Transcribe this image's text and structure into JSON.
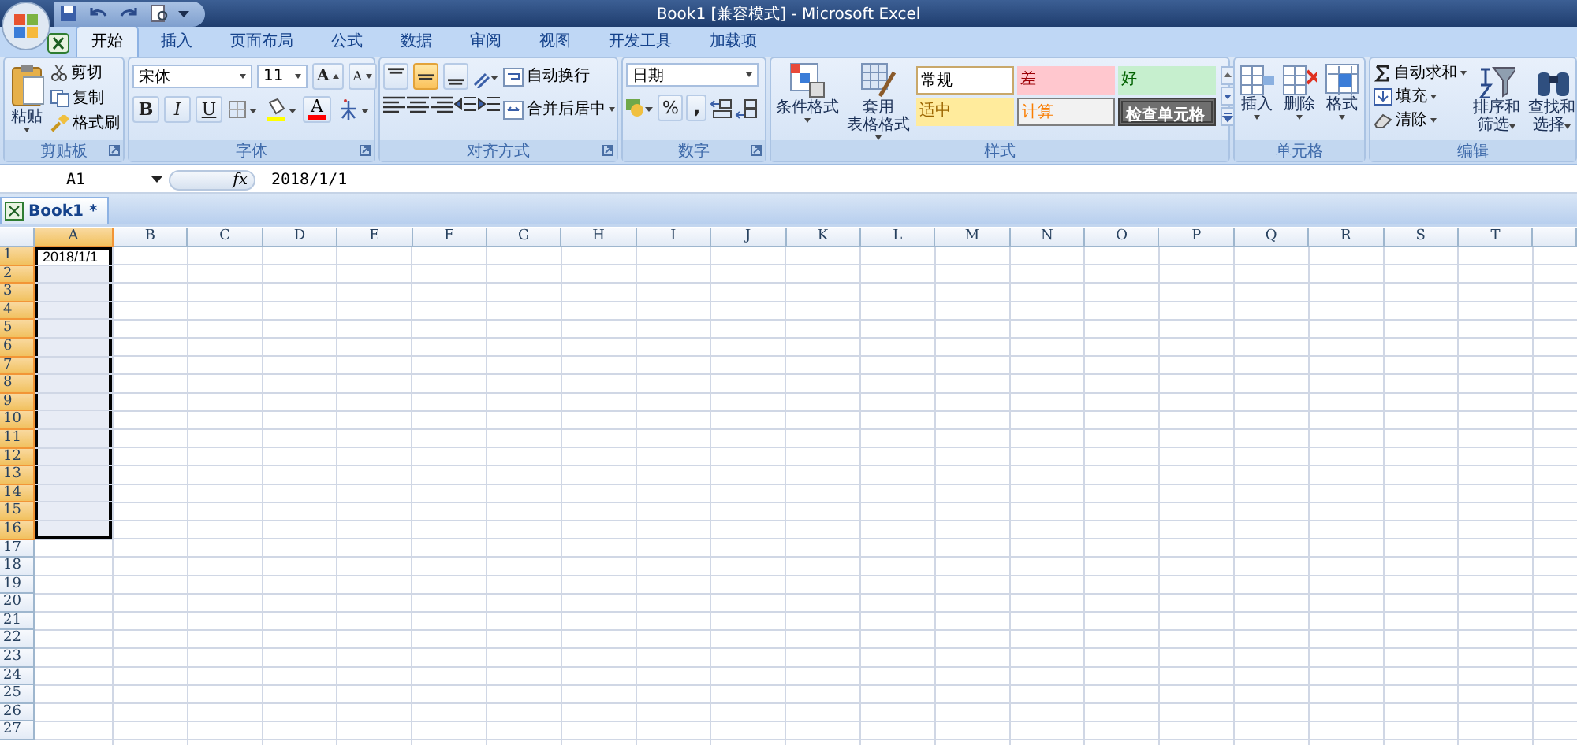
{
  "window": {
    "title": "Book1  [兼容模式] - Microsoft Excel"
  },
  "tabs": [
    {
      "label": "开始",
      "selected": true
    },
    {
      "label": "插入",
      "selected": false
    },
    {
      "label": "页面布局",
      "selected": false
    },
    {
      "label": "公式",
      "selected": false
    },
    {
      "label": "数据",
      "selected": false
    },
    {
      "label": "审阅",
      "selected": false
    },
    {
      "label": "视图",
      "selected": false
    },
    {
      "label": "开发工具",
      "selected": false
    },
    {
      "label": "加载项",
      "selected": false
    }
  ],
  "ribbon": {
    "groups": [
      {
        "kind": "clipboard",
        "label": "剪贴板",
        "large": "粘贴",
        "items": [
          "剪切",
          "复制",
          "格式刷"
        ]
      },
      {
        "kind": "font",
        "label": "字体",
        "font": "宋体",
        "size": "11",
        "grow": "A",
        "shrink": "A",
        "bold": "B",
        "italic": "I",
        "underline": "U",
        "font_color": "A"
      },
      {
        "kind": "alignment",
        "label": "对齐方式",
        "valign": [
          {
            "selected": false
          },
          {
            "selected": true
          },
          {
            "selected": false
          }
        ],
        "wrap": "自动换行",
        "merge": "合并后居中"
      },
      {
        "kind": "number",
        "label": "数字",
        "format": "日期",
        "percent": "%",
        "comma": ","
      },
      {
        "kind": "styles",
        "label": "样式",
        "buttons": [
          [
            "条件格式"
          ],
          [
            "套用",
            "表格格式"
          ]
        ],
        "gallery": [
          {
            "label": "常规",
            "kind": "normal"
          },
          {
            "label": "差",
            "kind": "bad"
          },
          {
            "label": "好",
            "kind": "good"
          },
          {
            "label": "适中",
            "kind": "neutral"
          },
          {
            "label": "计算",
            "kind": "calculation"
          },
          {
            "label": "检查单元格",
            "kind": "check"
          }
        ]
      },
      {
        "kind": "cells",
        "label": "单元格",
        "buttons": [
          "插入",
          "删除",
          "格式"
        ]
      },
      {
        "kind": "editing",
        "label": "编辑",
        "small": [
          "自动求和",
          "填充",
          "清除"
        ],
        "large": [
          [
            "排序和",
            "筛选"
          ],
          [
            "查找和",
            "选择"
          ]
        ]
      }
    ]
  },
  "formula_bar": {
    "name_box": "A1",
    "function_label": "fx",
    "value": "2018/1/1"
  },
  "workbook_tab": {
    "label": "Book1 *"
  },
  "sheet": {
    "columns": [
      {
        "label": "A",
        "selected": true
      },
      {
        "label": "B",
        "selected": false
      },
      {
        "label": "C",
        "selected": false
      },
      {
        "label": "D",
        "selected": false
      },
      {
        "label": "E",
        "selected": false
      },
      {
        "label": "F",
        "selected": false
      },
      {
        "label": "G",
        "selected": false
      },
      {
        "label": "H",
        "selected": false
      },
      {
        "label": "I",
        "selected": false
      },
      {
        "label": "J",
        "selected": false
      },
      {
        "label": "K",
        "selected": false
      },
      {
        "label": "L",
        "selected": false
      },
      {
        "label": "M",
        "selected": false
      },
      {
        "label": "N",
        "selected": false
      },
      {
        "label": "O",
        "selected": false
      },
      {
        "label": "P",
        "selected": false
      },
      {
        "label": "Q",
        "selected": false
      },
      {
        "label": "R",
        "selected": false
      },
      {
        "label": "S",
        "selected": false
      },
      {
        "label": "T",
        "selected": false
      }
    ],
    "rows": [
      {
        "label": "1",
        "selected": true,
        "cells": [
          "2018/1/1"
        ]
      },
      {
        "label": "2",
        "selected": true
      },
      {
        "label": "3",
        "selected": true
      },
      {
        "label": "4",
        "selected": true
      },
      {
        "label": "5",
        "selected": true
      },
      {
        "label": "6",
        "selected": true
      },
      {
        "label": "7",
        "selected": true
      },
      {
        "label": "8",
        "selected": true
      },
      {
        "label": "9",
        "selected": true
      },
      {
        "label": "10",
        "selected": true
      },
      {
        "label": "11",
        "selected": true
      },
      {
        "label": "12",
        "selected": true
      },
      {
        "label": "13",
        "selected": true
      },
      {
        "label": "14",
        "selected": true
      },
      {
        "label": "15",
        "selected": true
      },
      {
        "label": "16",
        "selected": true
      },
      {
        "label": "17",
        "selected": false
      },
      {
        "label": "18",
        "selected": false
      },
      {
        "label": "19",
        "selected": false
      },
      {
        "label": "20",
        "selected": false
      },
      {
        "label": "21",
        "selected": false
      },
      {
        "label": "22",
        "selected": false
      },
      {
        "label": "23",
        "selected": false
      },
      {
        "label": "24",
        "selected": false
      },
      {
        "label": "25",
        "selected": false
      },
      {
        "label": "26",
        "selected": false
      },
      {
        "label": "27",
        "selected": false
      }
    ]
  }
}
